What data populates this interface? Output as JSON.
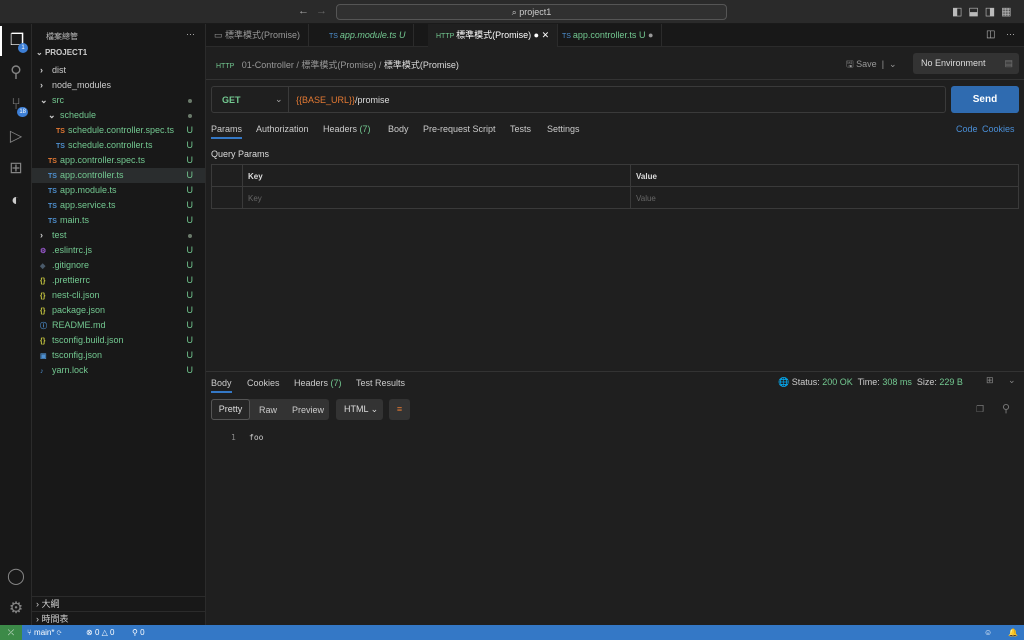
{
  "titlebar": {
    "search": "project1",
    "nav_back": "←",
    "nav_fwd": "→"
  },
  "activity": {
    "explorer_badge": "1",
    "scm_badge": "18"
  },
  "sidebar": {
    "title": "檔案總管",
    "more": "···",
    "project": "PROJECT1",
    "tree": [
      {
        "name": "dist",
        "type": "folder",
        "depth": 0,
        "open": false
      },
      {
        "name": "node_modules",
        "type": "folder",
        "depth": 0,
        "open": false
      },
      {
        "name": "src",
        "type": "folder",
        "depth": 0,
        "open": true,
        "status": "dot"
      },
      {
        "name": "schedule",
        "type": "folder",
        "depth": 1,
        "open": true,
        "status": "dot"
      },
      {
        "name": "schedule.controller.spec.ts",
        "type": "tss",
        "depth": 2,
        "status": "U"
      },
      {
        "name": "schedule.controller.ts",
        "type": "ts",
        "depth": 2,
        "status": "U"
      },
      {
        "name": "app.controller.spec.ts",
        "type": "tss",
        "depth": 1,
        "status": "U"
      },
      {
        "name": "app.controller.ts",
        "type": "ts",
        "depth": 1,
        "status": "U",
        "selected": true
      },
      {
        "name": "app.module.ts",
        "type": "ts",
        "depth": 1,
        "status": "U"
      },
      {
        "name": "app.service.ts",
        "type": "ts",
        "depth": 1,
        "status": "U"
      },
      {
        "name": "main.ts",
        "type": "ts",
        "depth": 1,
        "status": "U"
      },
      {
        "name": "test",
        "type": "folder",
        "depth": 0,
        "open": false,
        "status": "dot"
      },
      {
        "name": ".eslintrc.js",
        "type": "js",
        "depth": 0,
        "status": "U"
      },
      {
        "name": ".gitignore",
        "type": "git",
        "depth": 0,
        "status": "U"
      },
      {
        "name": ".prettierrc",
        "type": "json",
        "depth": 0,
        "status": "U"
      },
      {
        "name": "nest-cli.json",
        "type": "json",
        "depth": 0,
        "status": "U"
      },
      {
        "name": "package.json",
        "type": "json",
        "depth": 0,
        "status": "U"
      },
      {
        "name": "README.md",
        "type": "info",
        "depth": 0,
        "status": "U"
      },
      {
        "name": "tsconfig.build.json",
        "type": "json",
        "depth": 0,
        "status": "U"
      },
      {
        "name": "tsconfig.json",
        "type": "tsconfig",
        "depth": 0,
        "status": "U"
      },
      {
        "name": "yarn.lock",
        "type": "yarn",
        "depth": 0,
        "status": "U"
      }
    ],
    "outline": "大綱",
    "timeline": "時間表"
  },
  "tabs": [
    {
      "label": "標準模式(Promise)"
    },
    {
      "label": "app.module.ts",
      "status": "U"
    },
    {
      "label": "標準模式(Promise)",
      "active": true
    },
    {
      "label": "app.controller.ts",
      "status": "U"
    }
  ],
  "breadcrumb": [
    "01-Controller",
    "標準模式(Promise)",
    "標準模式(Promise)"
  ],
  "request": {
    "save": "Save",
    "environment": "No Environment",
    "method": "GET",
    "url_var": "{{BASE_URL}}",
    "url_path": "/promise",
    "send": "Send",
    "tabs": [
      "Params",
      "Authorization",
      "Headers",
      "Body",
      "Pre-request Script",
      "Tests",
      "Settings"
    ],
    "headers_count": "(7)",
    "code": "Code",
    "cookies": "Cookies",
    "query_params": "Query Params",
    "col_key": "Key",
    "col_value": "Value",
    "ph_key": "Key",
    "ph_value": "Value"
  },
  "response": {
    "tabs": [
      "Body",
      "Cookies",
      "Headers",
      "Test Results"
    ],
    "headers_count": "(7)",
    "status_label": "Status:",
    "status": "200 OK",
    "time_label": "Time:",
    "time": "308 ms",
    "size_label": "Size:",
    "size": "229 B",
    "views": [
      "Pretty",
      "Raw",
      "Preview"
    ],
    "format": "HTML",
    "line_no": "1",
    "body": "foo"
  },
  "statusbar": {
    "branch": "main*",
    "errors": "0",
    "warnings": "0",
    "ports": "0"
  },
  "colors": {
    "accent": "#3478c6",
    "send": "#2f6bb0",
    "untracked": "#73c991",
    "status_ok": "#6bbd6e"
  }
}
